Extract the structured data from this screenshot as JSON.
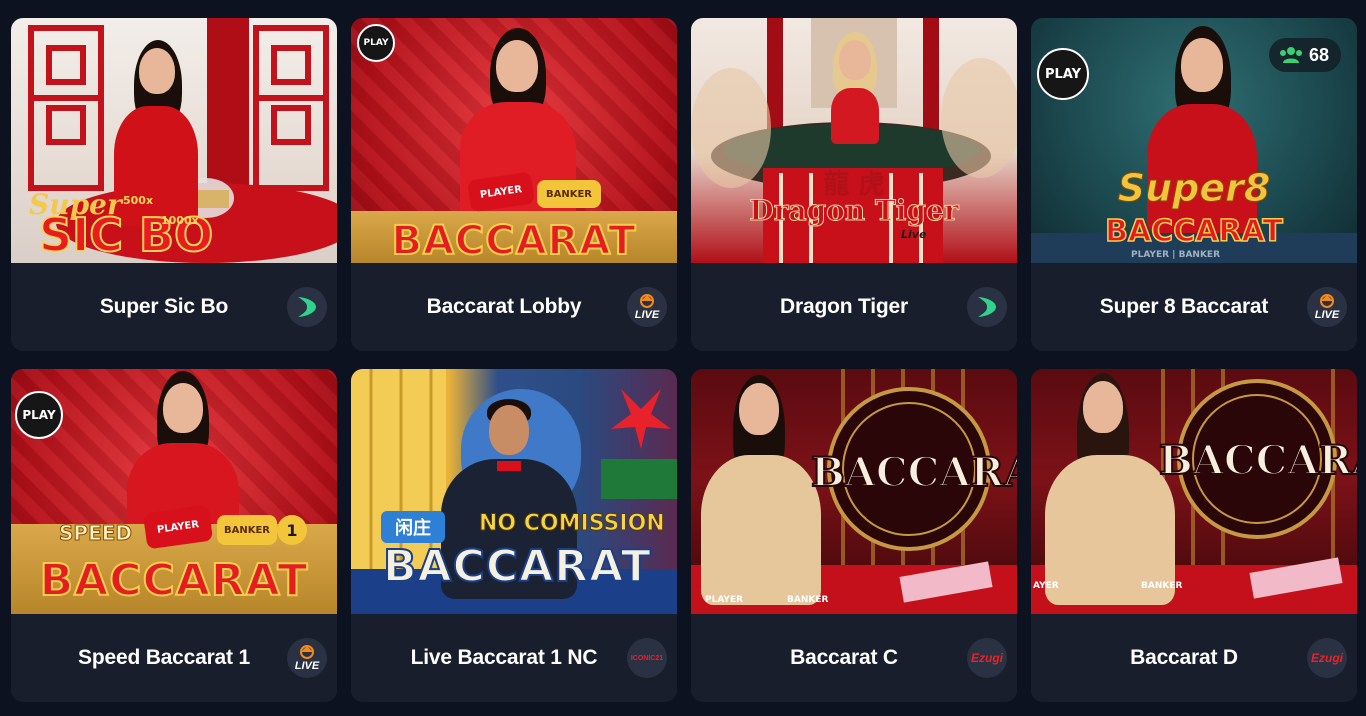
{
  "games": [
    {
      "title": "Super Sic Bo",
      "provider_icon": "evolution-icon",
      "art": {
        "logo_line1": "Super",
        "logo_line2": "SIC BO",
        "multiplier1": "500x",
        "multiplier2": "1000x"
      }
    },
    {
      "title": "Baccarat Lobby",
      "provider_icon": "pragmatic-live-icon",
      "provider_label": "LIVE",
      "art": {
        "play_label": "PLAY",
        "player_label": "PLAYER",
        "banker_label": "BANKER",
        "logo": "BACCARAT"
      }
    },
    {
      "title": "Dragon Tiger",
      "provider_icon": "evolution-icon",
      "art": {
        "logo_line1": "Dragon Tiger",
        "logo_line2": "Live",
        "glyphs": "龍 虎"
      }
    },
    {
      "title": "Super 8 Baccarat",
      "provider_icon": "pragmatic-live-icon",
      "provider_label": "LIVE",
      "art": {
        "play_label": "PLAY",
        "logo_line1": "Super8",
        "logo_line2": "BACCARAT",
        "players_count": "68",
        "table_text": "PLAYER | BANKER"
      }
    },
    {
      "title": "Speed Baccarat 1",
      "provider_icon": "pragmatic-live-icon",
      "provider_label": "LIVE",
      "art": {
        "play_label": "PLAY",
        "speed_label": "SPEED",
        "player_label": "PLAYER",
        "banker_label": "BANKER",
        "table_number": "1",
        "logo": "BACCARAT"
      }
    },
    {
      "title": "Live Baccarat 1 NC",
      "provider_icon": "ezugi-icon",
      "provider_label": "ICONIC21",
      "art": {
        "tag": "闲庄",
        "line1": "NO COMISSION",
        "line2": "BACCARAT"
      }
    },
    {
      "title": "Baccarat C",
      "provider_icon": "ezugi-icon",
      "provider_label": "Ezugi",
      "art": {
        "logo": "BACCARAT",
        "player_label": "PLAYER",
        "banker_label": "BANKER"
      }
    },
    {
      "title": "Baccarat D",
      "provider_icon": "ezugi-icon",
      "provider_label": "Ezugi",
      "art": {
        "logo": "BACCARAT",
        "player_label": "AYER",
        "banker_label": "BANKER"
      }
    }
  ],
  "colors": {
    "page_bg": "#0c1220",
    "card_bg": "#181e2c",
    "evolution_green": "#2fd38b",
    "live_orange": "#f28b1b",
    "red_main": "#c8101a"
  }
}
